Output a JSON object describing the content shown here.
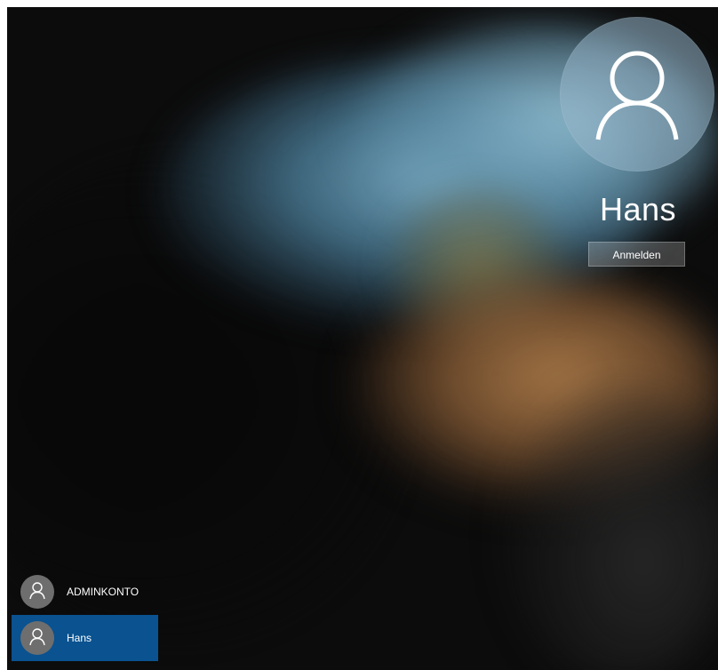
{
  "lock_screen": {
    "selected_user": {
      "name": "Hans",
      "avatar_icon": "user-icon"
    },
    "signin_button_label": "Anmelden",
    "accounts": [
      {
        "label": "ADMINKONTO",
        "icon": "user-icon",
        "selected": false
      },
      {
        "label": "Hans",
        "icon": "user-icon",
        "selected": true
      }
    ]
  },
  "colors": {
    "selected_account_bg": "#0a5290",
    "avatar_gray": "#6e6e6e",
    "text": "#ffffff"
  }
}
